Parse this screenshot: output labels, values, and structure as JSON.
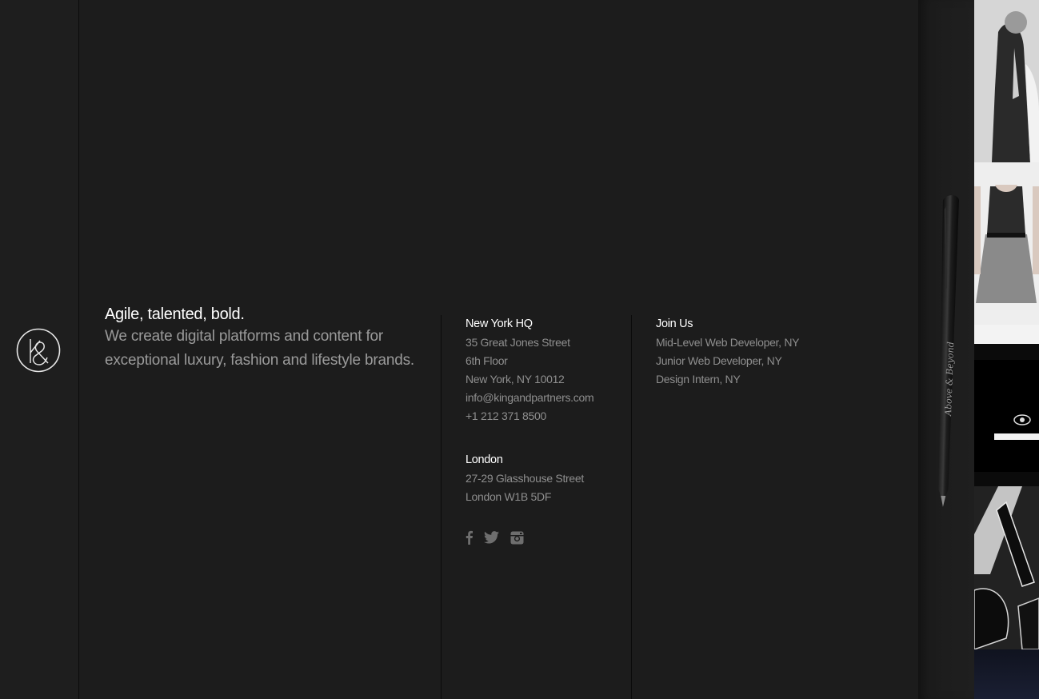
{
  "brand": {
    "logo_text": "K&",
    "tagline_lead": "Agile, talented, bold.",
    "tagline_body": "We create digital platforms and content for exceptional luxury, fashion and lifestyle brands."
  },
  "offices": {
    "new_york": {
      "heading": "New York HQ",
      "lines": [
        "35 Great Jones Street",
        "6th Floor",
        "New York, NY 10012"
      ],
      "email": "info@kingandpartners.com",
      "phone": "+1 212 371 8500"
    },
    "london": {
      "heading": "London",
      "lines": [
        "27-29 Glasshouse Street",
        "London W1B 5DF"
      ]
    }
  },
  "social": {
    "icons": [
      "facebook-icon",
      "twitter-icon",
      "instagram-icon"
    ]
  },
  "join": {
    "heading": "Join Us",
    "jobs": [
      "Mid-Level Web Developer, NY",
      "Junior Web Developer, NY",
      "Design Intern, NY"
    ]
  },
  "pen": {
    "engraving": "Above & Beyond"
  },
  "colors": {
    "background": "#1c1c1c",
    "heading": "#ffffff",
    "body_text": "#8e8e8e",
    "tagline_body": "#9a9a9a"
  }
}
